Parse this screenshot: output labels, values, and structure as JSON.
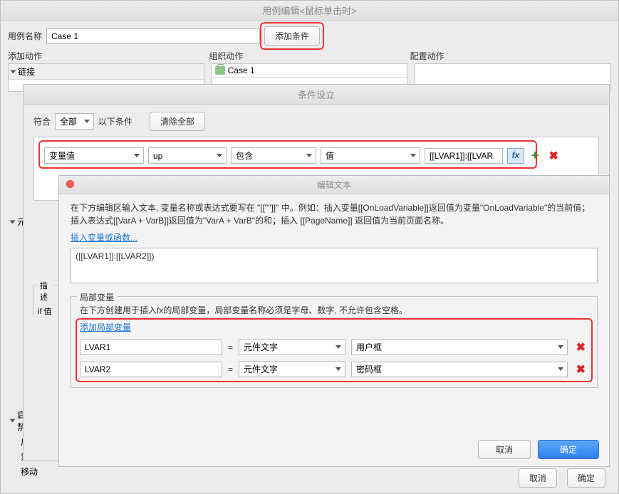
{
  "main": {
    "title": "用例编辑<鼠标单击时>",
    "caseNameLabel": "用例名称",
    "caseName": "Case 1",
    "addConditionBtn": "添加条件",
    "sections": {
      "add": "添加动作",
      "org": "组织动作",
      "cfg": "配置动作"
    },
    "tree": {
      "link": "链接",
      "caseItem": "Case 1"
    },
    "side": {
      "meta": "元",
      "enable": "启用/禁",
      "start": "启",
      "stop": "禁",
      "move": "移动"
    },
    "footer": {
      "cancel": "取消",
      "ok": "确定"
    }
  },
  "cond": {
    "title": "条件设立",
    "matchLabel": "符合",
    "matchAll": "全部",
    "suffix": "以下条件",
    "clearAll": "清除全部",
    "row": {
      "c1": "变量值",
      "c2": "up",
      "c3": "包含",
      "c4": "值",
      "c5": "[[LVAR1]]:[[LVAR"
    },
    "descLabel": "描述",
    "ifLabel": "if 值"
  },
  "et": {
    "title": "编辑文本",
    "help": "在下方编辑区输入文本, 变量名称或表达式要写在 \"[[\"\"]]\" 中。例如：插入变量[[OnLoadVariable]]返回值为变量\"OnLoadVariable\"的当前值；插入表达式[[VarA + VarB]]返回值为\"VarA + VarB\"的和；插入 [[PageName]] 返回值为当前页面名称。",
    "insertLink": "插入变量或函数...",
    "expr": "([[LVAR1]]:[[LVAR2]])",
    "local": {
      "legend": "局部变量",
      "note": "在下方创建用于插入fx的局部变量，局部变量名称必须是字母、数字, 不允许包含空格。",
      "addLink": "添加局部变量",
      "rows": [
        {
          "name": "LVAR1",
          "type": "元件文字",
          "target": "用户框"
        },
        {
          "name": "LVAR2",
          "type": "元件文字",
          "target": "密码框"
        }
      ]
    },
    "footer": {
      "cancel": "取消",
      "ok": "确定"
    }
  }
}
